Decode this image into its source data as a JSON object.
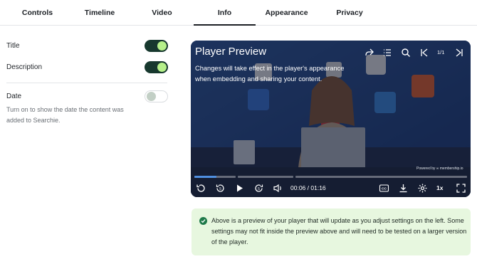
{
  "tabs": [
    {
      "label": "Controls"
    },
    {
      "label": "Timeline"
    },
    {
      "label": "Video"
    },
    {
      "label": "Info",
      "active": true
    },
    {
      "label": "Appearance"
    },
    {
      "label": "Privacy"
    }
  ],
  "settings": {
    "title_label": "Title",
    "title_on": true,
    "description_label": "Description",
    "description_on": true,
    "date_label": "Date",
    "date_on": false,
    "date_hint": "Turn on to show the date the content was added to Searchie."
  },
  "player": {
    "title": "Player Preview",
    "description": "Changes will take effect in the player's appearance when embedding and sharing your content.",
    "counter": "1/1",
    "powered_by": "Powered by ∞ membership.io",
    "current_time": "00:06",
    "duration": "01:16",
    "time_separator": " / ",
    "speed": "1x",
    "progress_fraction": 0.08,
    "top_icons": [
      "share-icon",
      "chapters-list-icon",
      "search-icon",
      "previous-icon",
      "next-icon"
    ],
    "control_icons": [
      "rewind-icon",
      "skip-back-5-icon",
      "play-icon",
      "skip-forward-5-icon",
      "volume-icon",
      "captions-icon",
      "download-icon",
      "settings-icon",
      "fullscreen-icon"
    ]
  },
  "notice": {
    "text": "Above is a preview of your player that will update as you adjust settings on the left. Some settings may not fit inside the preview above and will need to be tested on a larger version of the player."
  },
  "colors": {
    "toggle_on": "#17382e",
    "toggle_knob_on": "#b6f08a",
    "progress": "#4f8fe0",
    "notice_bg": "#e7f7df",
    "check": "#1f7a4a"
  }
}
